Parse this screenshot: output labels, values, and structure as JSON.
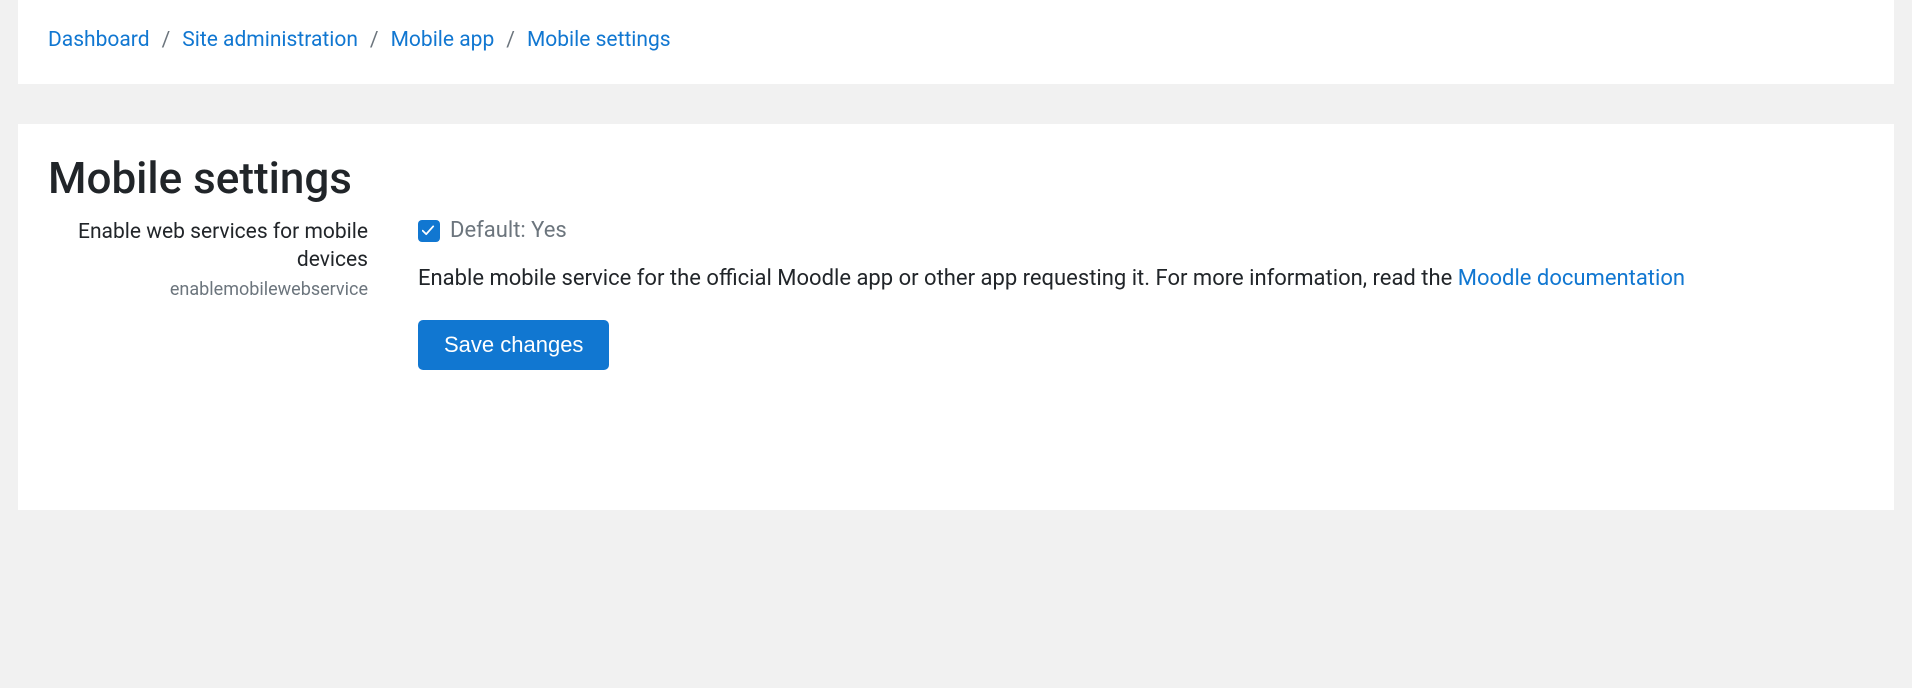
{
  "breadcrumb": {
    "items": [
      {
        "label": "Dashboard"
      },
      {
        "label": "Site administration"
      },
      {
        "label": "Mobile app"
      },
      {
        "label": "Mobile settings"
      }
    ]
  },
  "page": {
    "title": "Mobile settings"
  },
  "setting": {
    "label": "Enable web services for mobile devices",
    "key": "enablemobilewebservice",
    "default_text": "Default: Yes",
    "checked": true,
    "description_prefix": "Enable mobile service for the official Moodle app or other app requesting it. For more information, read the ",
    "doc_link_text": "Moodle documentation"
  },
  "actions": {
    "save_label": "Save changes"
  }
}
